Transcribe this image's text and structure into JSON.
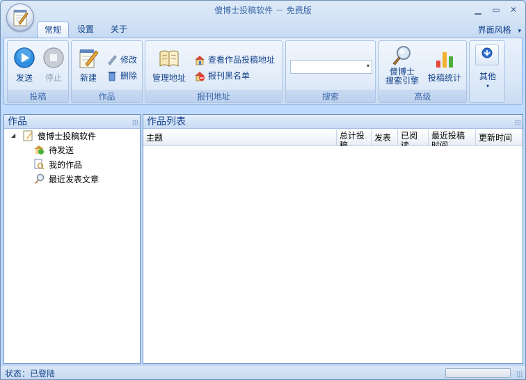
{
  "window": {
    "title": "傻博士投稿软件 － 免费版",
    "controls": {
      "minimize": "▁",
      "maximize": "▭",
      "close": "✕"
    }
  },
  "tabs": [
    {
      "label": "常规",
      "active": true
    },
    {
      "label": "设置",
      "active": false
    },
    {
      "label": "关于",
      "active": false
    }
  ],
  "skin_menu": {
    "label": "界面风格",
    "arrow": "▾"
  },
  "ribbon": {
    "groups": {
      "submit": {
        "label": "投稿",
        "send": "发送",
        "stop": "停止"
      },
      "works": {
        "label": "作品",
        "new": "新建",
        "edit": "修改",
        "delete": "删除"
      },
      "journal": {
        "label": "报刊地址",
        "manage": "管理地址",
        "view": "查看作品投稿地址",
        "blacklist": "报刊黑名单"
      },
      "search": {
        "label": "搜索",
        "combo_value": "",
        "combo_arrow": "▾"
      },
      "advanced": {
        "label": "高级",
        "engine_line1": "傻博士",
        "engine_line2": "搜索引擎",
        "stats": "投稿统计"
      },
      "other": {
        "label": "其他",
        "arrow": "▾"
      }
    }
  },
  "left_panel": {
    "title": "作品",
    "tree": {
      "expander": "◢",
      "root": "傻博士投稿软件",
      "children": [
        "待发送",
        "我的作品",
        "最近发表文章"
      ]
    }
  },
  "right_panel": {
    "title": "作品列表",
    "columns": [
      "主题",
      "总计投稿",
      "发表",
      "已阅读",
      "最近投稿时间",
      "更新时间"
    ],
    "rows": []
  },
  "status": {
    "text": "状态：已登陆",
    "progress": 0
  },
  "colors": {
    "accent": "#15428b",
    "ribbon": "#dbe8f7",
    "border": "#6f8fb8"
  }
}
